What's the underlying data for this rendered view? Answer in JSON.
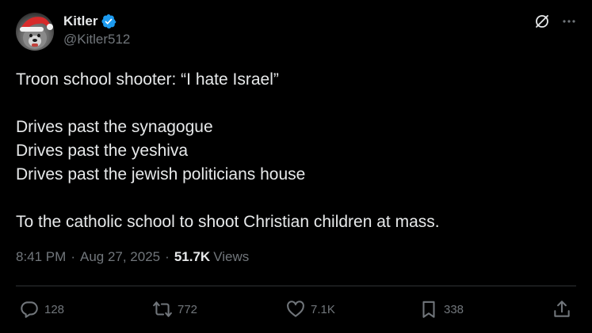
{
  "author": {
    "display_name": "Kitler",
    "handle": "@Kitler512",
    "verified": true
  },
  "post": {
    "lines": [
      "Troon school shooter: “I hate Israel”",
      "",
      "Drives past the synagogue",
      "Drives past the yeshiva",
      "Drives past the jewish politicians house",
      "",
      "To the catholic school to shoot Christian children at mass."
    ],
    "time": "8:41 PM",
    "separator": "·",
    "date": "Aug 27, 2025",
    "views_count": "51.7K",
    "views_label": "Views"
  },
  "actions": {
    "replies": "128",
    "reposts": "772",
    "likes": "7.1K",
    "bookmarks": "338"
  },
  "colors": {
    "background": "#000000",
    "text": "#e7e9ea",
    "muted": "#71767b",
    "verified": "#1d9bf0",
    "divider": "#2f3336"
  },
  "icons": {
    "verified": "verified-badge-icon",
    "grok": "grok-icon",
    "more": "more-icon",
    "reply": "reply-icon",
    "repost": "repost-icon",
    "like": "like-icon",
    "bookmark": "bookmark-icon",
    "share": "share-icon"
  }
}
